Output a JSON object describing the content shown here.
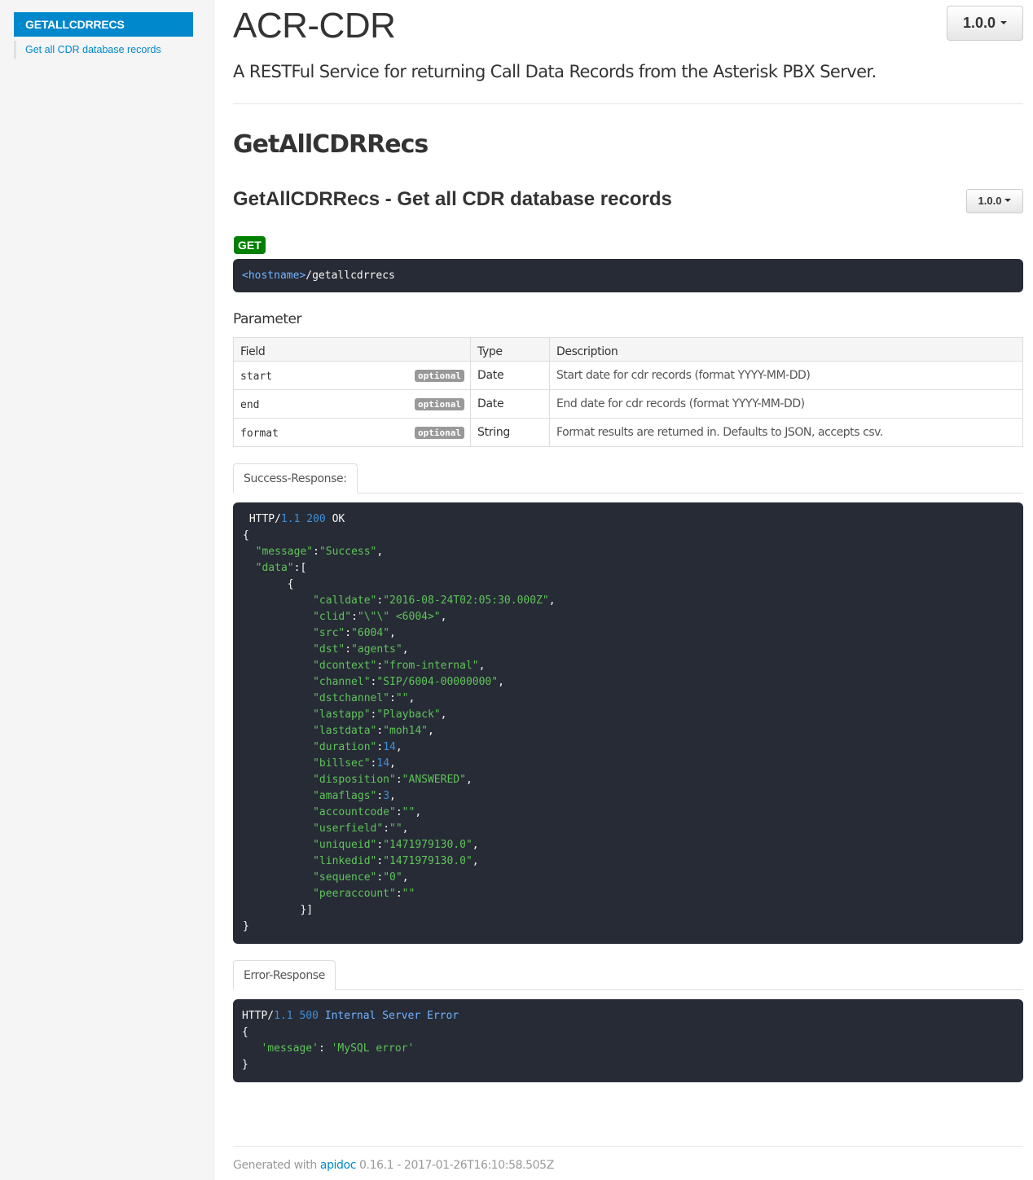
{
  "sidebar": {
    "header": "GETALLCDRRECS",
    "items": [
      {
        "label": "Get all CDR database records"
      }
    ]
  },
  "header": {
    "title": "ACR-CDR",
    "version_label": "1.0.0",
    "description": "A RESTFul Service for returning Call Data Records from the Asterisk PBX Server."
  },
  "group": {
    "title": "GetAllCDRRecs"
  },
  "article": {
    "title": "GetAllCDRRecs - Get all CDR database records",
    "version_label": "1.0.0",
    "method": "GET",
    "endpoint_host": "<hostname>",
    "endpoint_path": "/getallcdrrecs"
  },
  "parameters": {
    "heading": "Parameter",
    "columns": [
      "Field",
      "Type",
      "Description"
    ],
    "optional_label": "optional",
    "rows": [
      {
        "field": "start",
        "type": "Date",
        "description": "Start date for cdr records (format YYYY-MM-DD)"
      },
      {
        "field": "end",
        "type": "Date",
        "description": "End date for cdr records (format YYYY-MM-DD)"
      },
      {
        "field": "format",
        "type": "String",
        "description": "Format results are returned in. Defaults to JSON, accepts csv."
      }
    ]
  },
  "success": {
    "tab_label": "Success-Response:",
    "status_line": {
      "proto": "HTTP/",
      "version": "1.1",
      "code": "200",
      "text": "OK"
    },
    "message_key": "\"message\"",
    "message_value": "\"Success\"",
    "data_key": "\"data\"",
    "fields": [
      {
        "key": "\"calldate\"",
        "value": "\"2016-08-24T02:05:30.000Z\"",
        "kind": "str"
      },
      {
        "key": "\"clid\"",
        "value": "\"\\\"\\\" <6004>\"",
        "kind": "str"
      },
      {
        "key": "\"src\"",
        "value": "\"6004\"",
        "kind": "str"
      },
      {
        "key": "\"dst\"",
        "value": "\"agents\"",
        "kind": "str"
      },
      {
        "key": "\"dcontext\"",
        "value": "\"from-internal\"",
        "kind": "str"
      },
      {
        "key": "\"channel\"",
        "value": "\"SIP/6004-00000000\"",
        "kind": "str"
      },
      {
        "key": "\"dstchannel\"",
        "value": "\"\"",
        "kind": "str"
      },
      {
        "key": "\"lastapp\"",
        "value": "\"Playback\"",
        "kind": "str"
      },
      {
        "key": "\"lastdata\"",
        "value": "\"moh14\"",
        "kind": "str"
      },
      {
        "key": "\"duration\"",
        "value": "14",
        "kind": "num"
      },
      {
        "key": "\"billsec\"",
        "value": "14",
        "kind": "num"
      },
      {
        "key": "\"disposition\"",
        "value": "\"ANSWERED\"",
        "kind": "str"
      },
      {
        "key": "\"amaflags\"",
        "value": "3",
        "kind": "num"
      },
      {
        "key": "\"accountcode\"",
        "value": "\"\"",
        "kind": "str"
      },
      {
        "key": "\"userfield\"",
        "value": "\"\"",
        "kind": "str"
      },
      {
        "key": "\"uniqueid\"",
        "value": "\"1471979130.0\"",
        "kind": "str"
      },
      {
        "key": "\"linkedid\"",
        "value": "\"1471979130.0\"",
        "kind": "str"
      },
      {
        "key": "\"sequence\"",
        "value": "\"0\"",
        "kind": "str"
      },
      {
        "key": "\"peeraccount\"",
        "value": "\"\"",
        "kind": "str"
      }
    ]
  },
  "error": {
    "tab_label": "Error-Response",
    "status_line": {
      "proto": "HTTP/",
      "version": "1.1",
      "code": "500",
      "text": "Internal Server Error"
    },
    "message_key": "'message'",
    "message_value": "'MySQL error'"
  },
  "footer": {
    "prefix": "Generated with ",
    "link": "apidoc",
    "suffix": " 0.16.1 - 2017-01-26T16:10:58.505Z"
  },
  "colors": {
    "accent": "#0088cc",
    "code_bg": "#272b36",
    "get_badge": "#008000",
    "string": "#5fc35a",
    "number": "#3f8fd7"
  }
}
